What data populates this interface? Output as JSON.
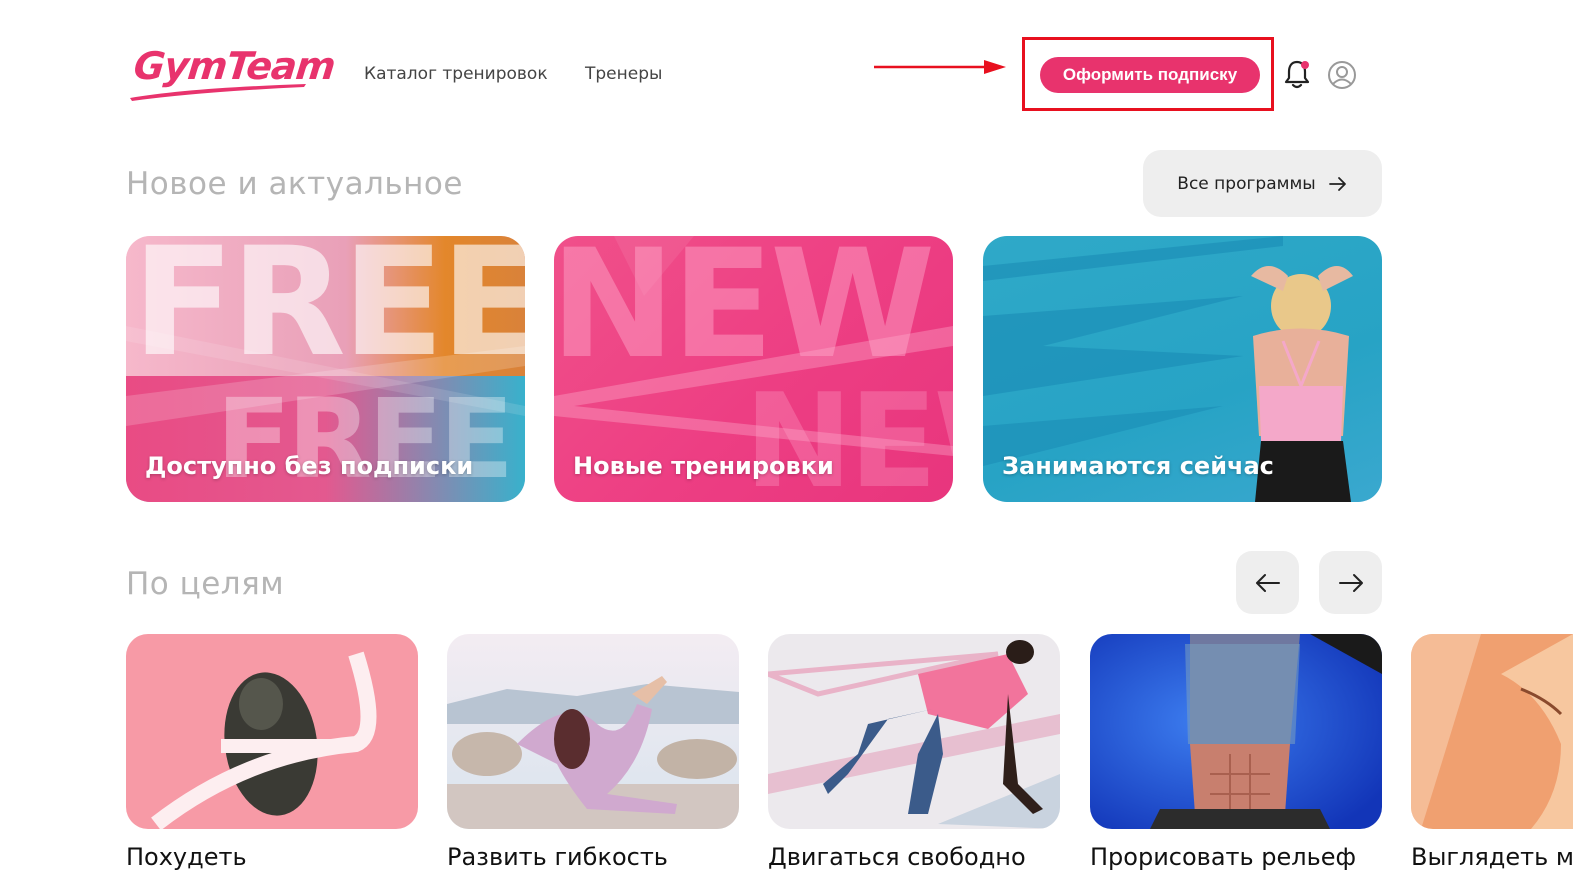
{
  "header": {
    "logo_text": "GymTeam",
    "nav": [
      {
        "label": "Каталог тренировок"
      },
      {
        "label": "Тренеры"
      }
    ],
    "subscribe_label": "Оформить подписку",
    "colors": {
      "brand": "#e8336d",
      "annotation": "#e8101f"
    }
  },
  "sections": {
    "new": {
      "title": "Новое и актуальное",
      "all_programs_label": "Все программы",
      "cards": [
        {
          "label": "Доступно без подписки",
          "bg_word": "FREE"
        },
        {
          "label": "Новые тренировки",
          "bg_word": "NEW"
        },
        {
          "label": "Занимаются сейчас"
        }
      ]
    },
    "goals": {
      "title": "По целям",
      "cards": [
        {
          "label": "Похудеть"
        },
        {
          "label": "Развить гибкость"
        },
        {
          "label": "Двигаться свободно"
        },
        {
          "label": "Прорисовать рельеф"
        },
        {
          "label": "Выглядеть м"
        }
      ]
    }
  },
  "icons": [
    "logo",
    "arrow-annotation",
    "bell-icon",
    "user-icon",
    "arrow-right-icon",
    "arrow-left-icon"
  ]
}
